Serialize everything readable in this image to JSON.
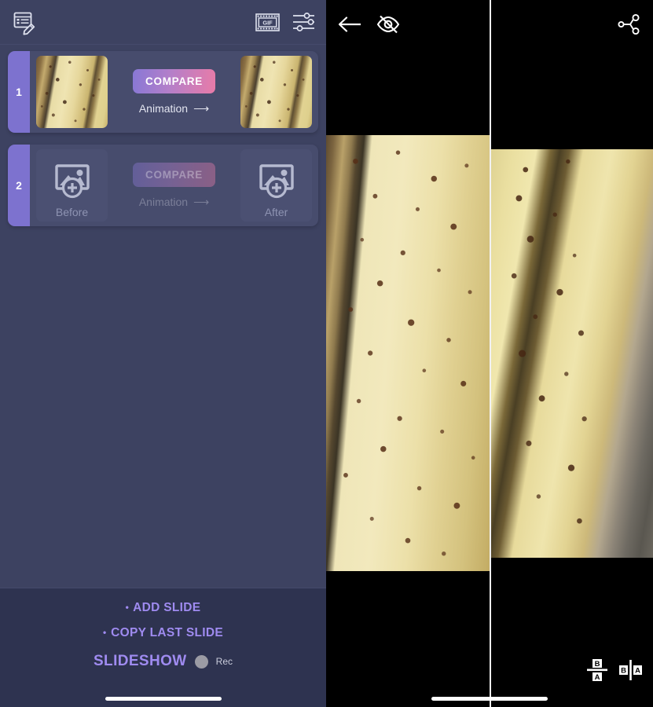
{
  "editor": {
    "toolbar": {
      "edit_list_icon": "edit-list-icon",
      "gif_icon": "gif-icon",
      "gif_label": "GIF",
      "adjustments_icon": "sliders-icon"
    },
    "slides": [
      {
        "index": "1",
        "filled": true,
        "compare_label": "COMPARE",
        "animation_label": "Animation",
        "animation_arrow": "⟶",
        "before_label": "",
        "after_label": ""
      },
      {
        "index": "2",
        "filled": false,
        "compare_label": "COMPARE",
        "animation_label": "Animation",
        "animation_arrow": "⟶",
        "before_label": "Before",
        "after_label": "After"
      }
    ],
    "actions": {
      "add_slide_plus": "•",
      "add_slide_label": "ADD SLIDE",
      "copy_slide_plus": "•",
      "copy_slide_label": "COPY LAST SLIDE",
      "slideshow_label": "SLIDESHOW",
      "rec_label": "Rec",
      "rec_dot_icon": "record-dot-icon"
    },
    "home_indicator": "home-indicator"
  },
  "preview": {
    "back_icon": "back-arrow-icon",
    "hide_icon": "eye-off-icon",
    "share_icon": "share-icon",
    "layout_stacked_icon": "layout-stacked-icon",
    "layout_sidebyside_icon": "layout-side-by-side-icon",
    "layout_letter_before": "B",
    "layout_letter_after": "A",
    "before_image": "banana-before-photo",
    "after_image": "banana-after-photo",
    "divider": "compare-divider",
    "home_indicator": "home-indicator"
  },
  "colors": {
    "panel_bg": "#3d4261",
    "bottom_bg": "#2e3350",
    "slide_bg": "#474c6d",
    "index_tab": "#7d72cf",
    "accent_purple": "#9f8bf0",
    "compare_from": "#8878d6",
    "compare_to": "#e87ba8",
    "preview_bg": "#000000",
    "divider": "#f2f2f2"
  }
}
